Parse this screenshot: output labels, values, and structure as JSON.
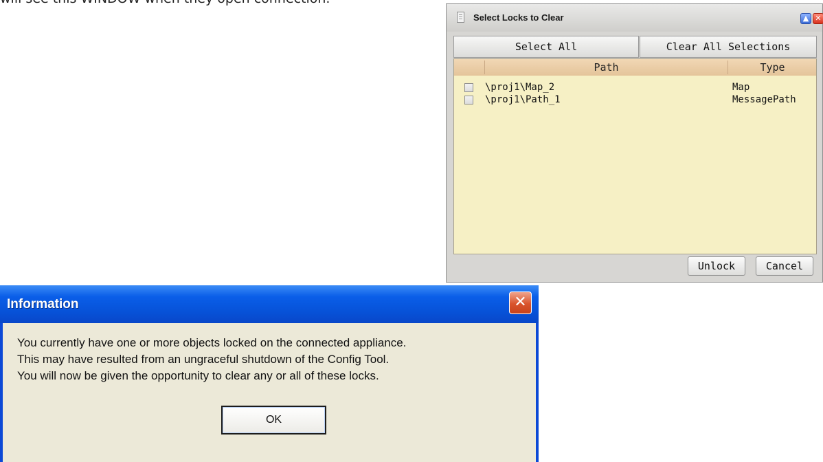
{
  "caption": "will see this WINDOW when they open connection.",
  "locks_window": {
    "title": "Select Locks to Clear",
    "icons": {
      "window": "document-icon",
      "maximize": "maximize-icon",
      "close": "close-icon"
    },
    "select_all_label": "Select All",
    "clear_all_label": "Clear All Selections",
    "columns": [
      "Path",
      "Type"
    ],
    "rows": [
      {
        "checked": false,
        "path": "\\proj1\\Map_2",
        "type": "Map"
      },
      {
        "checked": false,
        "path": "\\proj1\\Path_1",
        "type": "MessagePath"
      }
    ],
    "unlock_label": "Unlock",
    "cancel_label": "Cancel"
  },
  "info_dialog": {
    "title": "Information",
    "close_icon": "close-icon",
    "message_lines": [
      "You currently have one or more objects locked on the connected appliance.",
      "This may have resulted from an ungraceful shutdown of the Config Tool.",
      "You will now be given the opportunity to clear any or all of these locks."
    ],
    "ok_label": "OK"
  },
  "colors": {
    "xp_title_blue": "#0752d8",
    "dialog_body": "#ece9d8",
    "list_background": "#f6f0c5",
    "list_header": "#e4c49a"
  }
}
